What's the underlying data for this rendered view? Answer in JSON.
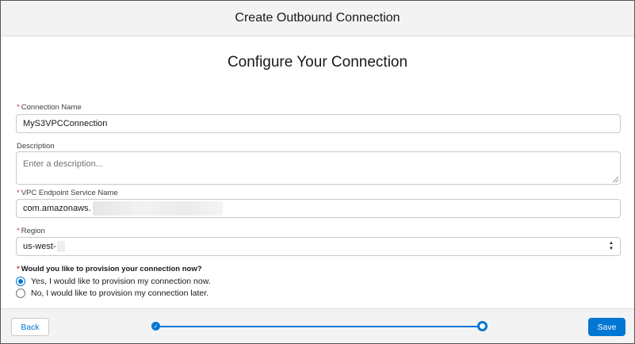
{
  "modal": {
    "title": "Create Outbound Connection",
    "step_title": "Configure Your Connection"
  },
  "form": {
    "connection_name": {
      "required_marker": "*",
      "label": "Connection Name",
      "value": "MyS3VPCConnection"
    },
    "description": {
      "label": "Description",
      "placeholder": "Enter a description..."
    },
    "vpc_endpoint": {
      "required_marker": "*",
      "label": "VPC Endpoint Service Name",
      "value_visible": "com.amazonaws."
    },
    "region": {
      "required_marker": "*",
      "label": "Region",
      "value_visible": "us-west-"
    },
    "provision": {
      "required_marker": "*",
      "question": "Would you like to provision your connection now?",
      "options": [
        {
          "label": "Yes, I would like to provision my connection now.",
          "checked": true
        },
        {
          "label": "No, I would like to provision my connection later.",
          "checked": false
        }
      ]
    }
  },
  "footer": {
    "back_label": "Back",
    "save_label": "Save",
    "progress": {
      "current_step": 2,
      "total_steps": 2
    }
  },
  "colors": {
    "brand": "#0176d3",
    "required": "#c23934",
    "header_bg": "#f3f3f3"
  },
  "icons": {
    "check": "check-icon",
    "select_arrows": "select-arrows-icon"
  }
}
